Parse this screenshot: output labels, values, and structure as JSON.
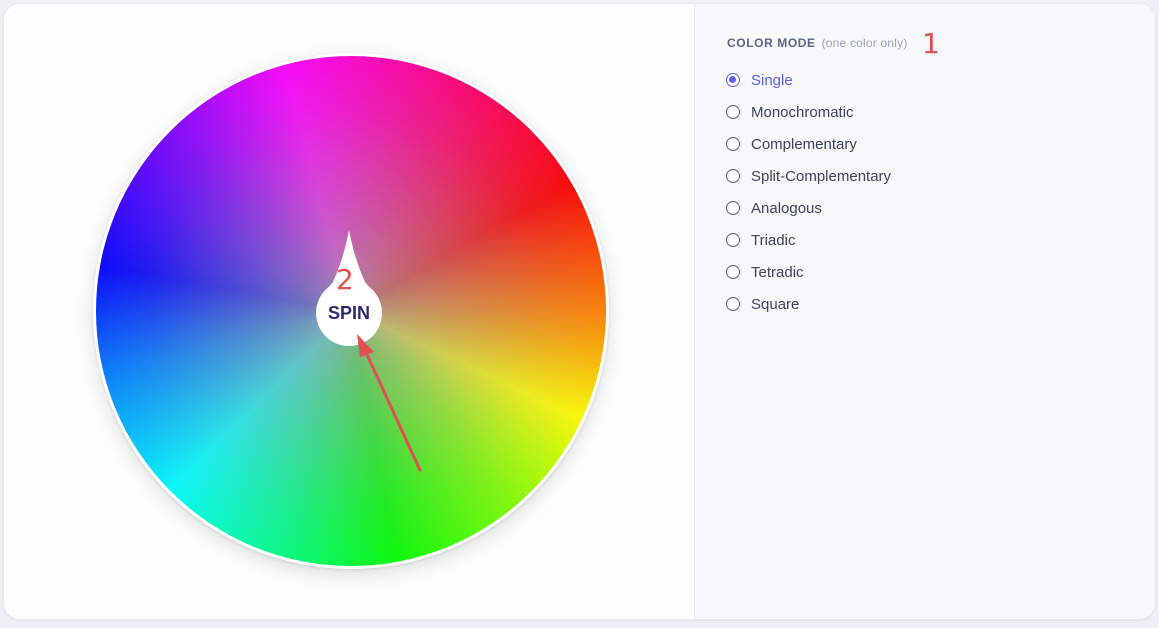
{
  "wheel": {
    "spin_label": "SPIN",
    "step_number": "2"
  },
  "panel": {
    "heading": "COLOR MODE",
    "heading_hint": "(one color only)",
    "step_number": "1",
    "selected_mode": "Single",
    "accent_color": "#5b63e6",
    "modes": [
      {
        "label": "Single",
        "checked": true
      },
      {
        "label": "Monochromatic",
        "checked": false
      },
      {
        "label": "Complementary",
        "checked": false
      },
      {
        "label": "Split-Complementary",
        "checked": false
      },
      {
        "label": "Analogous",
        "checked": false
      },
      {
        "label": "Triadic",
        "checked": false
      },
      {
        "label": "Tetradic",
        "checked": false
      },
      {
        "label": "Square",
        "checked": false
      }
    ]
  },
  "annotation_color": "#e05050"
}
